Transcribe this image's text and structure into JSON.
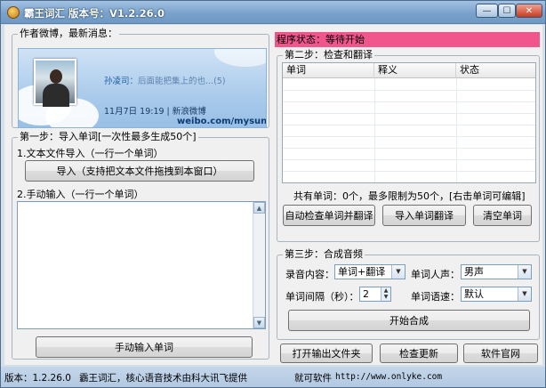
{
  "window": {
    "title": "霸王词汇  版本号：V1.2.26.0",
    "min_glyph": "—",
    "max_glyph": "☐",
    "close_glyph": "✕"
  },
  "author_box": {
    "legend": "作者微博，最新消息：",
    "card_name": "孙凌司：",
    "card_message": "后面能把集上的也...(5)",
    "card_meta": "11月7日 19:19 | 新浪微博",
    "card_url": "weibo.com/mysunck"
  },
  "step1": {
    "legend": "第一步：导入单词[一次性最多生成50个]",
    "file_import_label": "1.文本文件导入（一行一个单词）",
    "import_button": "导入（支持把文本文件拖拽到本窗口）",
    "manual_label": "2.手动输入（一行一个单词）",
    "manual_text": "",
    "manual_button": "手动输入单词"
  },
  "status": {
    "text": "程序状态：等待开始",
    "color": "#f0558c"
  },
  "step2": {
    "legend": "第二步：检查和翻译",
    "columns": [
      "单词",
      "释义",
      "状态"
    ],
    "rows": [],
    "summary": "共有单词：0个，最多限制为50个，[右击单词可编辑]",
    "check_button": "自动检查单词并翻译",
    "import_translate_button": "导入单词翻译",
    "clear_button": "清空单词"
  },
  "step3": {
    "legend": "第三步：合成音频",
    "content_label": "录音内容：",
    "content_value": "单词+翻译",
    "voice_label": "单词人声：",
    "voice_value": "男声",
    "interval_label": "单词间隔（秒）：",
    "interval_value": "2",
    "speed_label": "单词语速：",
    "speed_value": "默认",
    "start_button": "开始合成"
  },
  "bottom_buttons": {
    "open_folder": "打开输出文件夹",
    "check_update": "检查更新",
    "website": "软件官网"
  },
  "footer": {
    "version": "版本：1.2.26.0",
    "credit": "霸王词汇，核心语音技术由科大讯飞提供",
    "company": "就可软件",
    "url": "http://www.onlyke.com"
  }
}
